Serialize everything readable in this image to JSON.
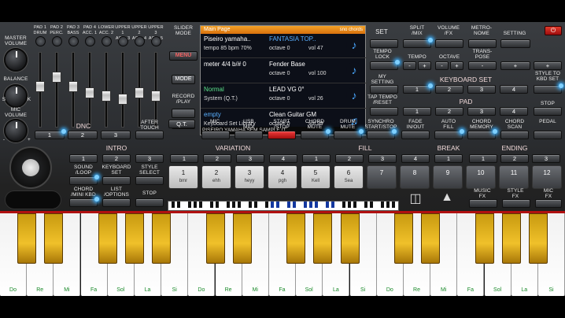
{
  "left": {
    "master_volume": "MASTER\nVOLUME",
    "balance": "BALANCE",
    "mic_volume": "MIC\nVOLUME",
    "s_label": "S",
    "k_label": "K",
    "minus": "-",
    "plus": "+"
  },
  "pads": [
    "PAD 1\nDRUM",
    "PAD 2\nPERC.",
    "PAD 3\nBASS",
    "PAD 4\nACC. 1",
    "LOWER\nACC. 2",
    "UPPER 1\nACC. 3",
    "UPPER 2\nACC. 4",
    "UPPER 3\nACC. 5"
  ],
  "fader_levels": [
    0.55,
    0.7,
    0.55,
    0.45,
    0.4,
    0.35,
    0.45,
    0.4
  ],
  "slider_mode": "SLIDER\nMODE",
  "menu": "MENU",
  "mode": "MODE",
  "record_play": "RECORD\n/PLAY",
  "qt": "Q.T.",
  "dnc": "DNC",
  "dnc_nums": [
    "1",
    "2",
    "3"
  ],
  "after_touch": "AFTER\nTOUCH",
  "screen": {
    "title": "Main Page",
    "corner": "sno chords",
    "rows": [
      {
        "a": "Piseiro yamaha..",
        "b": "tempo 85 bpm   70%",
        "c": "FANTASIA TOP..",
        "d": "octave 0",
        "e": "vol 47",
        "icon": "♪"
      },
      {
        "a": "meter 4/4  b/#  0",
        "b": "",
        "c": "Fender Base",
        "d": "octave 0",
        "e": "vol 100",
        "icon": "♪"
      },
      {
        "a": "Normal",
        "b": "System (Q.T.)",
        "c": "LEAD VG 0°",
        "d": "octave 0",
        "e": "vol 26",
        "icon": "♪"
      },
      {
        "a": "empty",
        "b": "Keyboard Set Library",
        "c": "Clean Guitar GM",
        "d": "octave 0",
        "e": "vol 99",
        "icon": "♫"
      }
    ],
    "footer": "PISEIRO YAMAHA SEM SAMPLE (T.."
  },
  "right": {
    "set": "SET",
    "split_mix": "SPLIT\n/MIX",
    "volume_fx": "VOLUME\n/FX",
    "metronome": "METRO-\nNOME",
    "setting": "SETTING",
    "tempo_lock": "TEMPO\nLOCK",
    "tempo": "TEMPO",
    "octave": "OCTAVE",
    "transpose": "TRANS-\nPOSE",
    "style_to_kbd": "STYLE TO\nKBD SET",
    "minus": "-",
    "plus": "+",
    "my_setting": "MY\nSETTING",
    "keyboard_set": "KEYBOARD SET",
    "kset_nums": [
      "1",
      "2",
      "3",
      "4"
    ],
    "tap_tempo": "TAP TEMPO\n/RESET",
    "pad": "PAD",
    "pad_nums": [
      "1",
      "2",
      "3",
      "4"
    ],
    "stop": "STOP",
    "power": "⏻"
  },
  "row2": {
    "mic": "MIC.",
    "usb_midi": "USB\nMIDI",
    "start_stop": "START\n/STOP",
    "chord_mute": "CHORD\nMUTE",
    "drum_mute": "DRUM\nMUTE",
    "synchro": "SYNCHRO\nSTART/STOP",
    "fade": "FADE\nIN/OUT",
    "auto_fill": "AUTO\nFILL",
    "chord_memory": "CHORD\nMEMORY",
    "chord_scan": "CHORD\nSCAN",
    "pedal": "PEDAL"
  },
  "sections": {
    "intro": "INTRO",
    "variation": "VARIATION",
    "fill": "FILL",
    "break": "BREAK",
    "ending": "ENDING"
  },
  "intro_nums": [
    "1",
    "2",
    "3"
  ],
  "var_nums": [
    "1",
    "2",
    "3",
    "4"
  ],
  "fill_nums": [
    "1",
    "2",
    "3",
    "4"
  ],
  "break_num": "1",
  "ending_nums": [
    "1",
    "2",
    "3"
  ],
  "left_buttons": {
    "sound_loop": "SOUND\n/LOOP",
    "keyboard_set": "KEYBOARD\nSET",
    "style_select": "STYLE\nSELECT",
    "chord_mini_kbd": "CHORD\n/MINI KBD",
    "list_options": "LIST\n/OPTIONS",
    "stop": "STOP"
  },
  "var_pads": [
    {
      "n": "1",
      "s": "bmr"
    },
    {
      "n": "2",
      "s": "ehh"
    },
    {
      "n": "3",
      "s": "heyy"
    },
    {
      "n": "4",
      "s": "pgh"
    },
    {
      "n": "5",
      "s": "Kell"
    },
    {
      "n": "6",
      "s": "Sea"
    },
    {
      "n": "7",
      "s": ""
    },
    {
      "n": "8",
      "s": ""
    },
    {
      "n": "9",
      "s": ""
    },
    {
      "n": "10",
      "s": ""
    },
    {
      "n": "11",
      "s": ""
    },
    {
      "n": "12",
      "s": ""
    }
  ],
  "music_fx": "MUSIC\nFX",
  "style_fx": "STYLE\nFX",
  "mic_fx": "MIC\nFX",
  "keys": [
    "Do",
    "Re",
    "Mi",
    "Fa",
    "Sol",
    "La",
    "Si",
    "Do",
    "Re",
    "Mi",
    "Fa",
    "Sol",
    "La",
    "Si",
    "Do",
    "Re",
    "Mi",
    "Fa",
    "Sol",
    "La",
    "Si"
  ],
  "colors": {
    "accent": "#f3a227",
    "lit": "#3ab0ff",
    "red": "#d21818",
    "key_label": "#1a8a2a"
  }
}
